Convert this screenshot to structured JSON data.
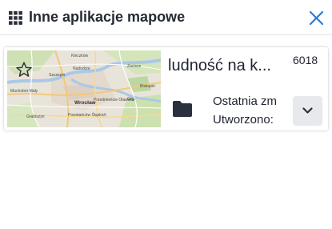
{
  "header": {
    "title": "Inne aplikacje mapowe",
    "menu_icon": "apps-grid-icon",
    "close_icon": "close-icon",
    "accent_color": "#2b7cd3"
  },
  "card": {
    "title": "ludność na k...",
    "id": "6018",
    "modified_label": "Ostatnia zm",
    "created_label": "Utworzono:",
    "favorite_icon": "star-outline-icon",
    "folder_icon": "folder-icon",
    "expand_icon": "chevron-down-icon",
    "map_labels": {
      "north": "Kleczków",
      "nw": "Szczepin",
      "center_n": "Nadodrze",
      "ne": "Zacisze",
      "center": "Wrocław",
      "center_s": "Przedmieście Oławskie",
      "west": "Muchobór Mały",
      "sw": "Grabiszyn",
      "south": "Powstańców Śląskich",
      "east": "Biskupin",
      "se": "Gaj"
    }
  }
}
